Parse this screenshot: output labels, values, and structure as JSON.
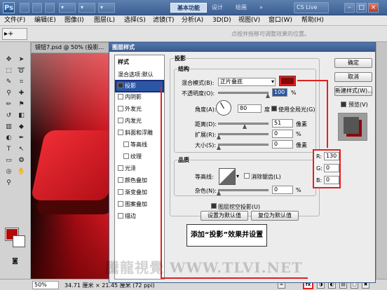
{
  "titlebar": {
    "app_icon": "Ps",
    "workspace_active": "基本功能",
    "workspace_design": "设计",
    "workspace_paint": "绘画",
    "workspace_more": "»",
    "cs_live": "CS Live",
    "buttons": {
      "minimize": "–",
      "restore": "□",
      "close": "×"
    }
  },
  "menubar": {
    "items": [
      "文件(F)",
      "编辑(E)",
      "图像(I)",
      "图层(L)",
      "选择(S)",
      "滤镜(T)",
      "分析(A)",
      "3D(D)",
      "视图(V)",
      "窗口(W)",
      "帮助(H)"
    ]
  },
  "options": {
    "tool_preset": "▸+",
    "hint": "点按并拖移可调整效果的位置。"
  },
  "document": {
    "tab": "镜钮7.psd @ 50% (投影...",
    "zoom": "50%",
    "size": "34.71 厘米 × 21.45 厘米 (72 ppi)"
  },
  "dialog": {
    "title": "图层样式",
    "styles_header": "样式",
    "blend_default": "混合选项:默认",
    "styles": [
      {
        "label": "投影",
        "checked": true
      },
      {
        "label": "内阴影",
        "checked": false
      },
      {
        "label": "外发光",
        "checked": false
      },
      {
        "label": "内发光",
        "checked": false
      },
      {
        "label": "斜面和浮雕",
        "checked": false
      },
      {
        "label": "等高线",
        "checked": false
      },
      {
        "label": "纹理",
        "checked": false
      },
      {
        "label": "光泽",
        "checked": false
      },
      {
        "label": "颜色叠加",
        "checked": false
      },
      {
        "label": "渐变叠加",
        "checked": false
      },
      {
        "label": "图案叠加",
        "checked": false
      },
      {
        "label": "描边",
        "checked": false
      }
    ],
    "section": "投影",
    "structure": {
      "title": "结构",
      "blend_mode_label": "混合模式(B):",
      "blend_mode": "正片叠底",
      "opacity_label": "不透明度(O):",
      "opacity": "100",
      "angle_label": "角度(A):",
      "angle": "80",
      "angle_unit": "度",
      "global_light": "使用全局光(G)",
      "distance_label": "距离(D):",
      "distance": "51",
      "spread_label": "扩展(R):",
      "spread": "0",
      "size_label": "大小(S):",
      "size": "0",
      "px": "像素",
      "percent": "%"
    },
    "quality": {
      "title": "品质",
      "contour_label": "等高线:",
      "anti_alias": "消除锯齿(L)",
      "noise_label": "杂色(N):",
      "noise": "0"
    },
    "knockout": "图层挖空投影(U)",
    "make_default": "设置为默认值",
    "reset_default": "复位为默认值",
    "buttons": {
      "ok": "确定",
      "cancel": "取消",
      "new_style": "新建样式(W)...",
      "preview": "预览(V)"
    },
    "colors": {
      "shadow": "#820A0A"
    }
  },
  "color_values": {
    "r_label": "R:",
    "r": "130",
    "g_label": "G:",
    "g": "0",
    "b_label": "B:",
    "b": "0"
  },
  "caption": "添加“投影”效果并设置",
  "watermark": "騰龍視覺 WWW.TLVI.NET"
}
